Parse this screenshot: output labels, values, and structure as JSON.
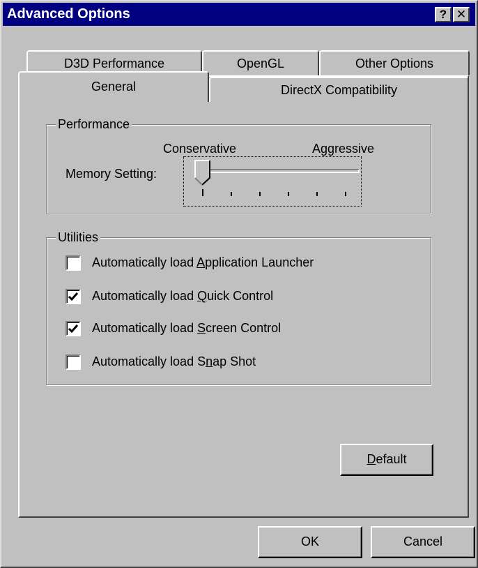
{
  "window": {
    "title": "Advanced Options",
    "help_label": "?",
    "close_label": "✕"
  },
  "tabs_back": [
    {
      "label": "D3D Performance"
    },
    {
      "label": "OpenGL"
    },
    {
      "label": "Other Options"
    }
  ],
  "tabs_front": [
    {
      "label": "General",
      "selected": true
    },
    {
      "label": "DirectX Compatibility",
      "selected": false
    }
  ],
  "performance": {
    "legend": "Performance",
    "left_label": "Conservative",
    "right_label": "Aggressive",
    "memory_label": "Memory Setting:",
    "slider_position": 0,
    "tick_count": 6
  },
  "utilities": {
    "legend": "Utilities",
    "items": [
      {
        "pre": "Automatically load ",
        "key": "A",
        "post": "pplication Launcher",
        "checked": false
      },
      {
        "pre": "Automatically load ",
        "key": "Q",
        "post": "uick Control",
        "checked": true
      },
      {
        "pre": "Automatically load ",
        "key": "S",
        "post": "creen Control",
        "checked": true
      },
      {
        "pre": "Automatically load S",
        "key": "n",
        "post": "ap Shot",
        "checked": false
      }
    ]
  },
  "buttons": {
    "default_key": "D",
    "default_rest": "efault",
    "ok": "OK",
    "cancel": "Cancel"
  }
}
